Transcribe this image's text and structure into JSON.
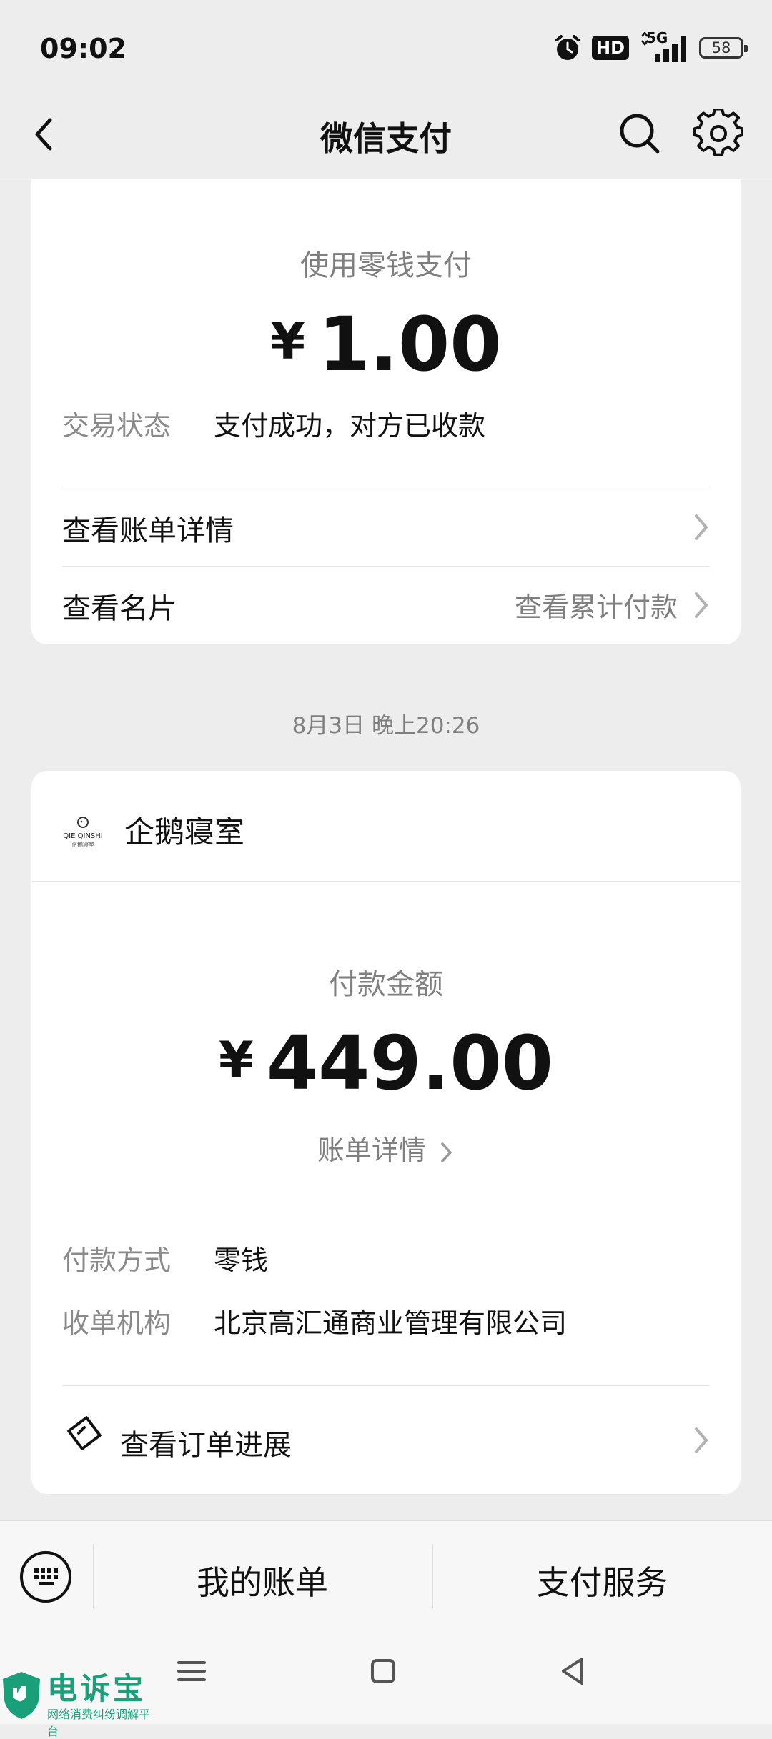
{
  "status_bar": {
    "time": "09:02",
    "network": "5G",
    "hd_label": "HD",
    "battery": "58",
    "icons": [
      "alarm-icon",
      "hd-icon",
      "signal-icon",
      "battery-icon"
    ]
  },
  "nav": {
    "title": "微信支付",
    "icons": [
      "back-icon",
      "search-icon",
      "gear-icon"
    ]
  },
  "card1": {
    "subtitle": "使用零钱支付",
    "currency": "¥",
    "amount": "1.00",
    "status_label": "交易状态",
    "status_value": "支付成功，对方已收款",
    "link_bill": "查看账单详情",
    "link_card": "查看名片",
    "link_cumulative": "查看累计付款"
  },
  "timestamp": "8月3日 晚上20:26",
  "card2": {
    "merchant_logo_text": "QIE QINSHI",
    "merchant_logo_sub": "企鹅寝室",
    "merchant_name": "企鹅寝室",
    "subtitle": "付款金额",
    "currency": "¥",
    "amount": "449.00",
    "bill_detail": "账单详情",
    "method_label": "付款方式",
    "method_value": "零钱",
    "acquirer_label": "收单机构",
    "acquirer_value": "北京高汇通商业管理有限公司",
    "order_progress": "查看订单进展"
  },
  "bottom_bar": {
    "my_bills": "我的账单",
    "pay_services": "支付服务"
  },
  "watermark": {
    "title": "电诉宝",
    "subtitle": "网络消费纠纷调解平台"
  },
  "colors": {
    "background": "#ededed",
    "card": "#ffffff",
    "muted_text": "#7f7f7f",
    "watermark": "#19a07a"
  }
}
